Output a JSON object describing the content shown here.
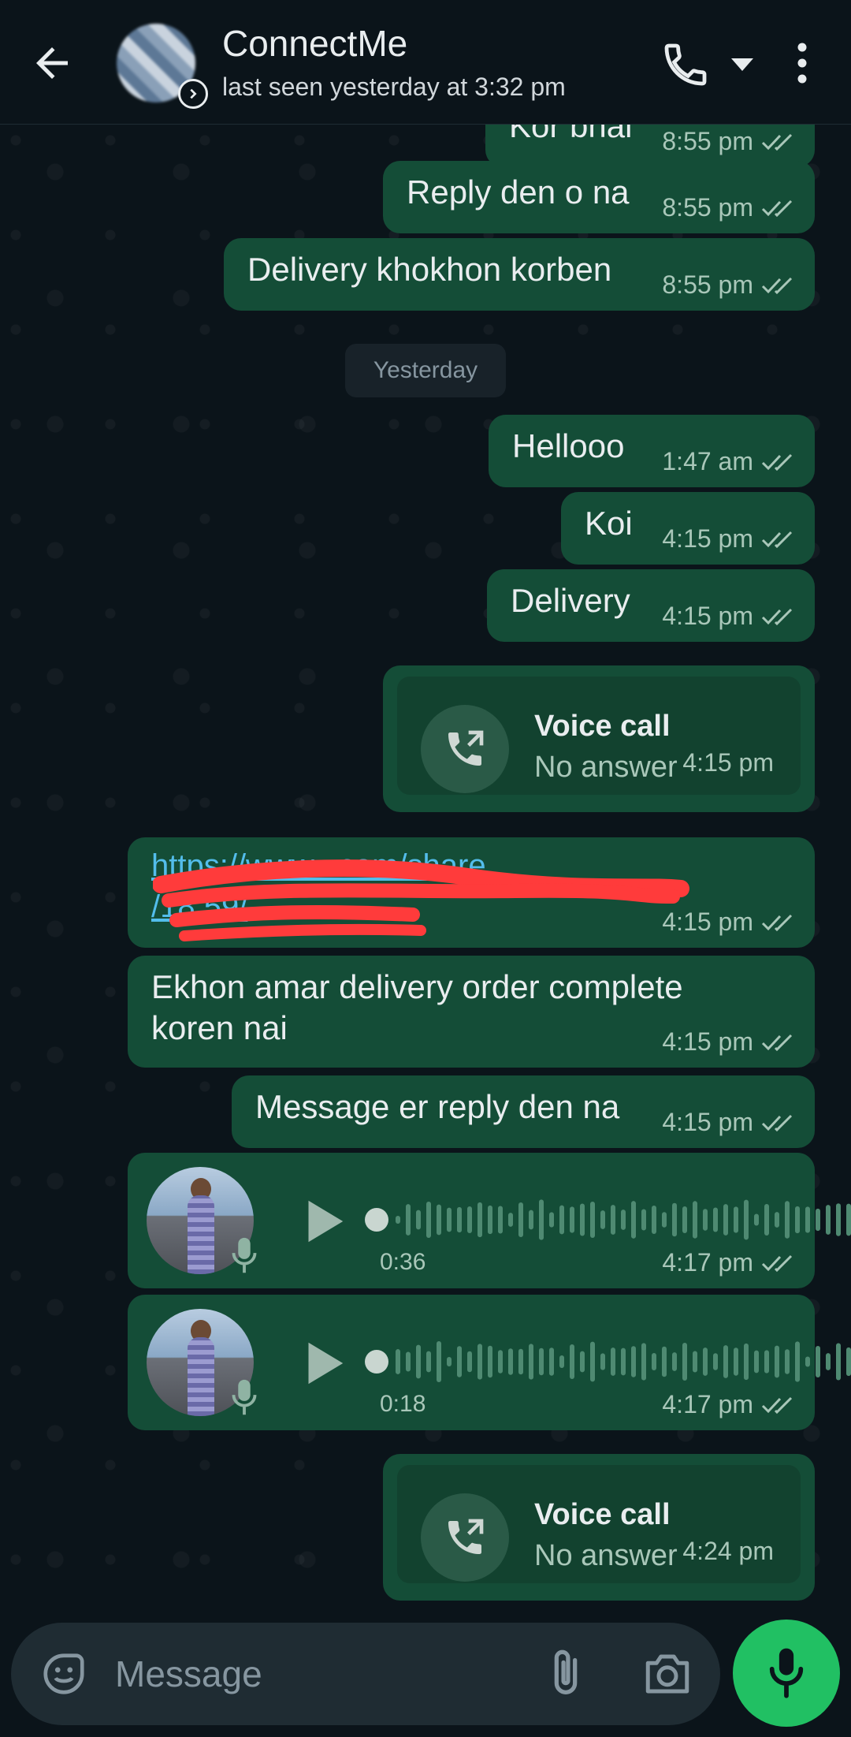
{
  "header": {
    "title": "ConnectMe",
    "status": "last seen yesterday at 3:32 pm"
  },
  "messages": [
    {
      "text": "Kor bhai",
      "time": "8:55 pm"
    },
    {
      "text": "Reply den o na",
      "time": "8:55 pm"
    },
    {
      "text": "Delivery khokhon korben",
      "time": "8:55 pm"
    },
    {
      "text": "Hellooo",
      "time": "1:47 am"
    },
    {
      "text": "Koi",
      "time": "4:15 pm"
    },
    {
      "text": "Delivery",
      "time": "4:15 pm"
    },
    {
      "text_line1": "Ekhon amar delivery order complete",
      "text_line2": "koren nai",
      "time": "4:15 pm"
    },
    {
      "text": "Message er reply den na",
      "time": "4:15 pm"
    }
  ],
  "date_separator": "Yesterday",
  "calls": [
    {
      "title": "Voice call",
      "status": "No answer",
      "time": "4:15 pm"
    },
    {
      "title": "Voice call",
      "status": "No answer",
      "time": "4:24 pm"
    }
  ],
  "link_message": {
    "line1": "https://www.        .com/share",
    "line2": "/18       59/",
    "time": "4:15 pm"
  },
  "voice_notes": [
    {
      "duration": "0:36",
      "time": "4:17 pm"
    },
    {
      "duration": "0:18",
      "time": "4:17 pm"
    }
  ],
  "composer": {
    "placeholder": "Message"
  },
  "colors": {
    "background": "#0b141a",
    "outgoing_bubble": "#144d37",
    "accent": "#21c063",
    "link": "#53bdeb"
  },
  "icons": [
    "back-arrow-icon",
    "call-icon",
    "dropdown-arrow-icon",
    "more-icon",
    "double-check-icon",
    "outgoing-call-icon",
    "play-icon",
    "mic-icon",
    "emoji-icon",
    "attach-icon",
    "camera-icon"
  ]
}
